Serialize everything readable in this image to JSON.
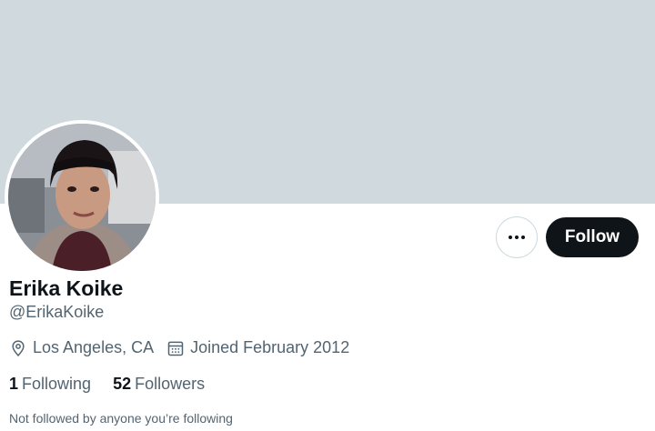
{
  "profile": {
    "name": "Erika Koike",
    "handle": "@ErikaKoike",
    "location": "Los Angeles, CA",
    "joined": "Joined February 2012",
    "following_count": "1",
    "following_label": "Following",
    "followers_count": "52",
    "followers_label": "Followers",
    "mutual_note": "Not followed by anyone you’re following"
  },
  "actions": {
    "follow_label": "Follow"
  },
  "icons": {
    "more": "more-horizontal-icon",
    "location": "location-pin-icon",
    "calendar": "calendar-icon"
  },
  "colors": {
    "banner": "#cfd9de",
    "follow_button_bg": "#0f1419",
    "secondary_text": "#536471"
  }
}
